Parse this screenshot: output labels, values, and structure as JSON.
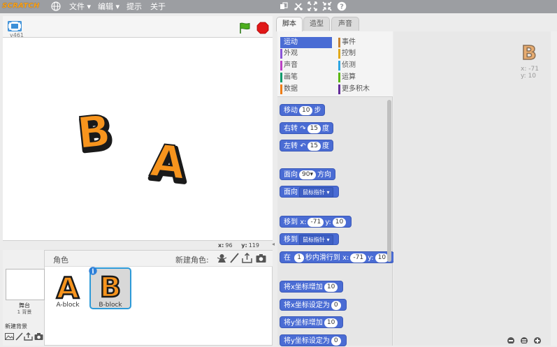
{
  "menubar": {
    "logo": "SCRATCH",
    "items": [
      "文件",
      "编辑",
      "提示",
      "关于"
    ],
    "tools": [
      "duplicate-icon",
      "delete-icon",
      "grow-icon",
      "shrink-icon",
      "help-icon"
    ]
  },
  "stage": {
    "version": "v461",
    "sprite_letters": [
      "B",
      "A"
    ],
    "coords_x_label": "x:",
    "coords_x": "96",
    "coords_y_label": "y:",
    "coords_y": "119"
  },
  "tabs": [
    "脚本",
    "造型",
    "声音"
  ],
  "categories": {
    "left": [
      {
        "label": "运动",
        "color": "#4a6cd4",
        "selected": true
      },
      {
        "label": "外观",
        "color": "#8a55d7"
      },
      {
        "label": "声音",
        "color": "#bb42c3"
      },
      {
        "label": "画笔",
        "color": "#0e9a6c"
      },
      {
        "label": "数据",
        "color": "#ee7d16"
      }
    ],
    "right": [
      {
        "label": "事件",
        "color": "#c88330"
      },
      {
        "label": "控制",
        "color": "#e1a91a"
      },
      {
        "label": "侦测",
        "color": "#2ca5e2"
      },
      {
        "label": "运算",
        "color": "#5cb712"
      },
      {
        "label": "更多积木",
        "color": "#632d99"
      }
    ]
  },
  "blocks": {
    "move": {
      "pre": "移动",
      "val": "10",
      "post": "步"
    },
    "turn_right": {
      "pre": "右转",
      "val": "15",
      "post": "度"
    },
    "turn_left": {
      "pre": "左转",
      "val": "15",
      "post": "度"
    },
    "point_dir": {
      "pre": "面向",
      "val": "90▾",
      "post": "方向"
    },
    "point_towards": {
      "pre": "面向",
      "drop": "鼠标指针 ▾"
    },
    "goto_xy": {
      "pre": "移到",
      "xl": "x:",
      "x": "-71",
      "yl": "y:",
      "y": "10"
    },
    "goto": {
      "pre": "移到",
      "drop": "鼠标指针 ▾"
    },
    "glide": {
      "pre": "在",
      "secs": "1",
      "mid": "秒内滑行到",
      "xl": "x:",
      "x": "-71",
      "yl": "y:",
      "y": "10"
    },
    "change_x": {
      "pre": "将x坐标增加",
      "val": "10"
    },
    "set_x": {
      "pre": "将x坐标设定为",
      "val": "0"
    },
    "change_y": {
      "pre": "将y坐标增加",
      "val": "10"
    },
    "set_y": {
      "pre": "将y坐标设定为",
      "val": "0"
    }
  },
  "sprites_panel": {
    "title": "角色",
    "new_sprite_label": "新建角色:",
    "stage_label": "舞台",
    "stage_count": "1 背景",
    "new_backdrop_label": "新建背景",
    "sprites": [
      {
        "name": "A-block",
        "letter": "A"
      },
      {
        "name": "B-block",
        "letter": "B",
        "selected": true
      }
    ]
  },
  "scripts_area": {
    "sprite_letter": "B",
    "x_text": "x: -71",
    "y_text": "y: 10"
  },
  "colors": {
    "menubar": "#9c9ea2",
    "motion": "#4a6cd4",
    "letter_fill": "#f7941d",
    "selected_sprite_border": "#2d9ad8"
  }
}
